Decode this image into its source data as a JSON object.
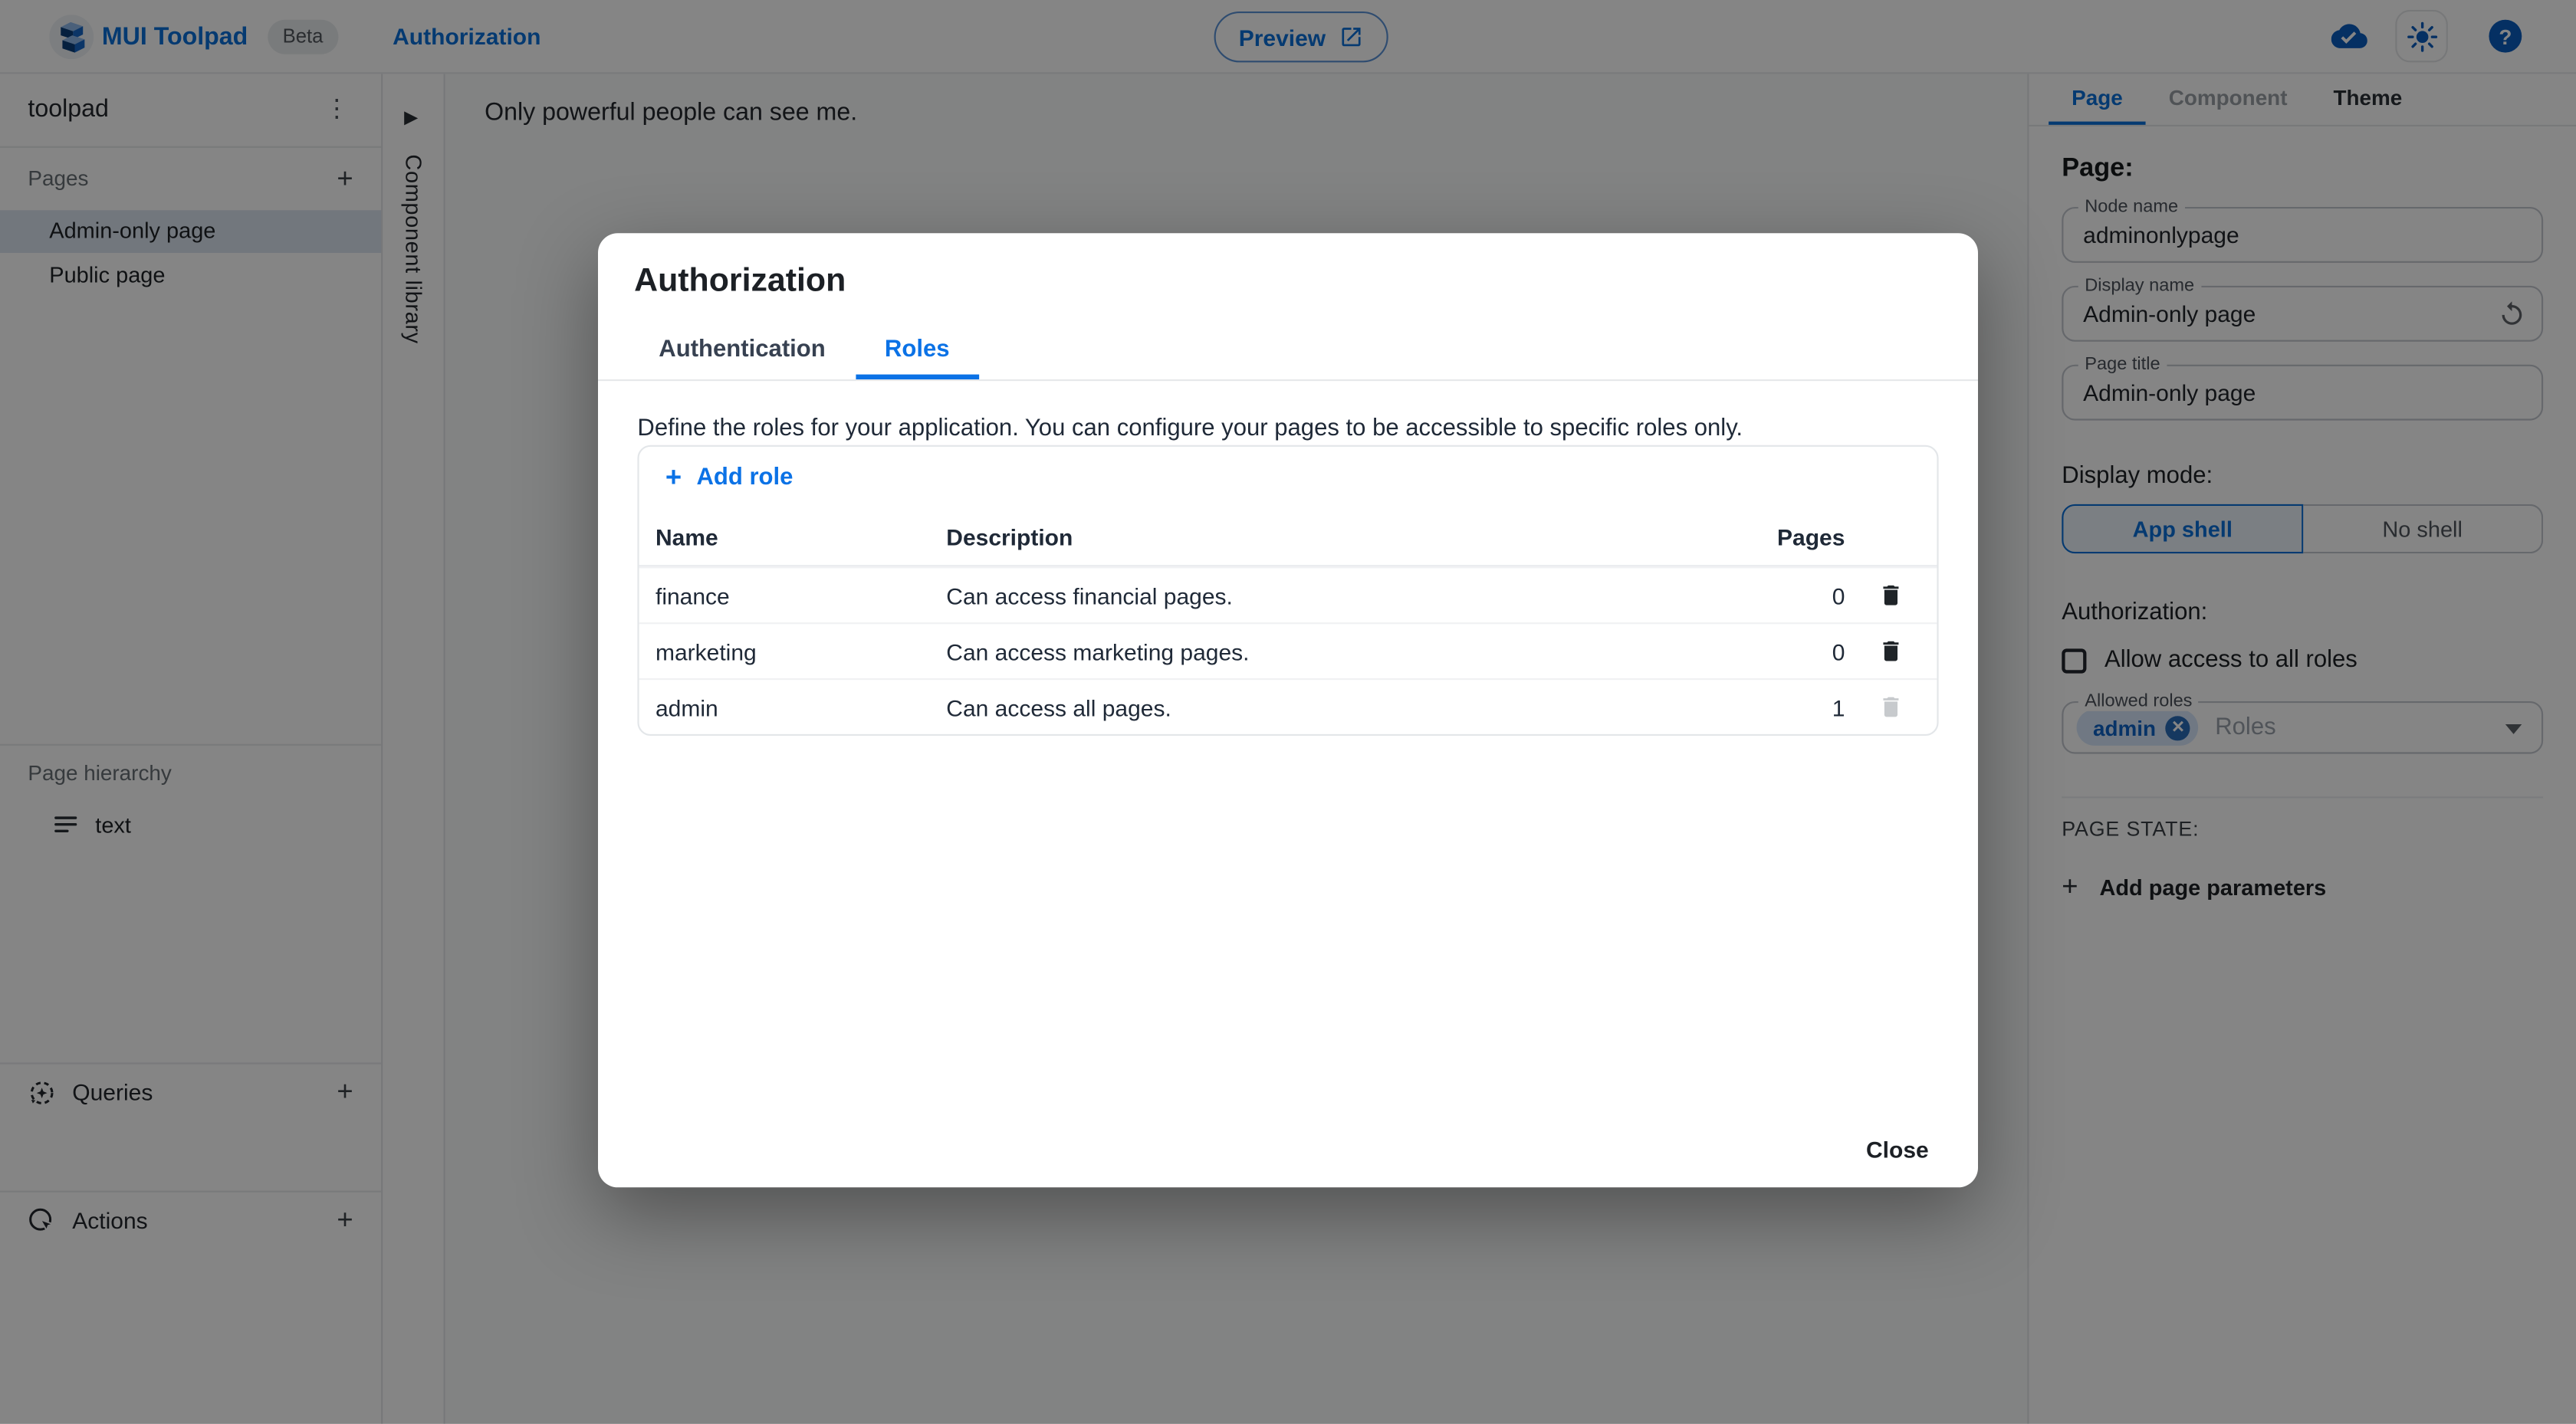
{
  "header": {
    "brand": "MUI Toolpad",
    "beta": "Beta",
    "breadcrumb": "Authorization",
    "preview_label": "Preview"
  },
  "sidebar": {
    "project_name": "toolpad",
    "pages_label": "Pages",
    "pages": [
      {
        "label": "Admin-only page",
        "selected": true
      },
      {
        "label": "Public page",
        "selected": false
      }
    ],
    "hierarchy_label": "Page hierarchy",
    "hierarchy_items": [
      {
        "label": "text"
      }
    ],
    "queries_label": "Queries",
    "actions_label": "Actions"
  },
  "component_library": {
    "label": "Component library"
  },
  "canvas": {
    "text": "Only powerful people can see me."
  },
  "dialog": {
    "title": "Authorization",
    "tabs": [
      {
        "label": "Authentication",
        "active": false
      },
      {
        "label": "Roles",
        "active": true
      }
    ],
    "description": "Define the roles for your application. You can configure your pages to be accessible to specific roles only.",
    "add_role_label": "Add role",
    "table": {
      "columns": [
        "Name",
        "Description",
        "Pages"
      ],
      "rows": [
        {
          "name": "finance",
          "description": "Can access financial pages.",
          "pages": "0",
          "delete_enabled": true
        },
        {
          "name": "marketing",
          "description": "Can access marketing pages.",
          "pages": "0",
          "delete_enabled": true
        },
        {
          "name": "admin",
          "description": "Can access all pages.",
          "pages": "1",
          "delete_enabled": false
        }
      ]
    },
    "close_label": "Close"
  },
  "inspector": {
    "tabs": [
      {
        "label": "Page",
        "active": true
      },
      {
        "label": "Component",
        "disabled": true
      },
      {
        "label": "Theme",
        "active": false
      }
    ],
    "heading": "Page:",
    "fields": [
      {
        "label": "Node name",
        "value": "adminonlypage"
      },
      {
        "label": "Display name",
        "value": "Admin-only page"
      },
      {
        "label": "Page title",
        "value": "Admin-only page"
      }
    ],
    "display_mode": {
      "label": "Display mode:",
      "options": [
        "App shell",
        "No shell"
      ],
      "selected": "App shell"
    },
    "authorization": {
      "label": "Authorization:",
      "checkbox_label": "Allow access to all roles",
      "checked": false,
      "allowed_roles": {
        "label": "Allowed roles",
        "chips": [
          "admin"
        ],
        "placeholder": "Roles"
      }
    },
    "page_state": {
      "label": "PAGE STATE:",
      "add_label": "Add page parameters"
    }
  },
  "icons": {
    "kebab": "⋮",
    "plus": "+",
    "collapse_arrow": "▶",
    "help": "?",
    "chip_remove": "✕"
  },
  "colors": {
    "primary_blue": "#0b6fd8",
    "tab_active_blue": "#0b72e6",
    "selected_item_bg": "#dbe4ef",
    "chip_bg": "#d7e7fb",
    "chip_text": "#0f62c5",
    "backdrop": "rgba(0,0,0,0.48)"
  }
}
